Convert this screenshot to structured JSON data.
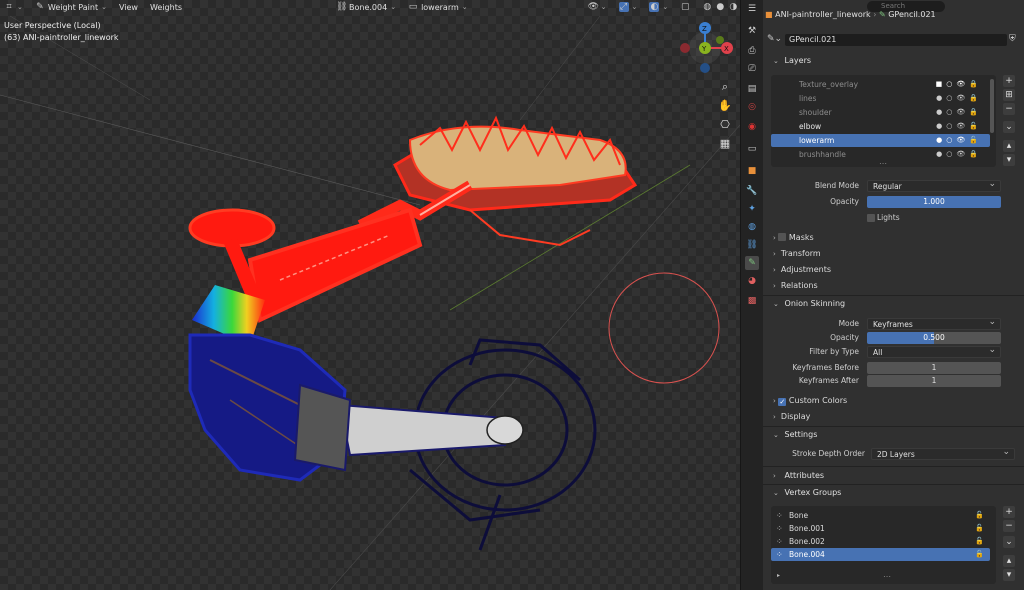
{
  "header": {
    "mode": "Weight Paint",
    "menus": [
      "View",
      "Weights"
    ],
    "bone": "Bone.004",
    "layer": "lowerarm"
  },
  "viewport": {
    "info_line1": "User Perspective (Local)",
    "info_line2": "(63) ANI-paintroller_linework",
    "gizmo": {
      "z": "Z",
      "x": "X",
      "y": "Y"
    }
  },
  "search": {
    "placeholder": "Search"
  },
  "breadcrumb": {
    "object": "ANI-paintroller_linework",
    "data": "GPencil.021"
  },
  "object_field": "GPencil.021",
  "layers": {
    "title": "Layers",
    "items": [
      {
        "name": "Texture_overlay"
      },
      {
        "name": "lines"
      },
      {
        "name": "shoulder"
      },
      {
        "name": "elbow"
      },
      {
        "name": "lowerarm"
      },
      {
        "name": "brushhandle"
      }
    ],
    "blend_mode_label": "Blend Mode",
    "blend_mode_value": "Regular",
    "opacity_label": "Opacity",
    "opacity_value": "1.000",
    "lights_label": "Lights",
    "sub_panels": [
      "Masks",
      "Transform",
      "Adjustments",
      "Relations"
    ]
  },
  "onion": {
    "title": "Onion Skinning",
    "mode_label": "Mode",
    "mode_value": "Keyframes",
    "opacity_label": "Opacity",
    "opacity_value": "0.500",
    "filter_label": "Filter by Type",
    "filter_value": "All",
    "before_label": "Keyframes Before",
    "before_value": "1",
    "after_label": "Keyframes After",
    "after_value": "1",
    "custom_colors_label": "Custom Colors",
    "display_label": "Display"
  },
  "settings": {
    "title": "Settings",
    "stroke_depth_label": "Stroke Depth Order",
    "stroke_depth_value": "2D Layers"
  },
  "attributes": {
    "title": "Attributes"
  },
  "vertex_groups": {
    "title": "Vertex Groups",
    "items": [
      {
        "name": "Bone"
      },
      {
        "name": "Bone.001"
      },
      {
        "name": "Bone.002"
      },
      {
        "name": "Bone.004"
      }
    ]
  },
  "colors": {
    "accent": "#4772b3",
    "panel_bg": "#303030",
    "x_axis": "#e0414b",
    "y_axis": "#8ab31f",
    "z_axis": "#3a7fd1"
  }
}
